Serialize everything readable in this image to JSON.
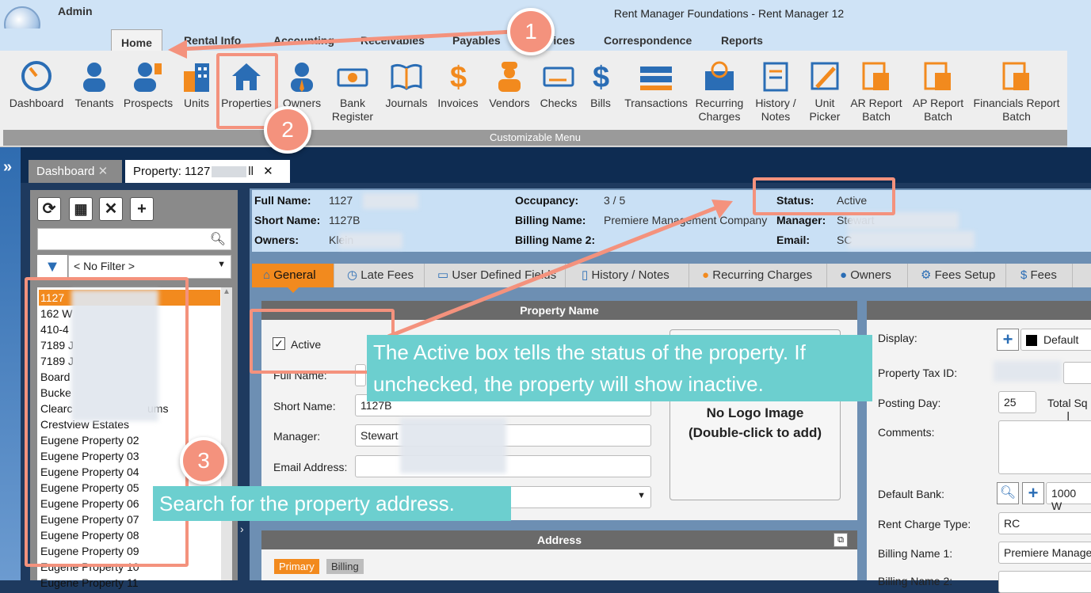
{
  "app": {
    "title": "Rent Manager Foundations - Rent Manager 12"
  },
  "menu_tabs": [
    "Admin",
    "Home",
    "Rental Info",
    "Accounting",
    "Receivables",
    "Payables",
    "Services",
    "Correspondence",
    "Reports"
  ],
  "ribbon": {
    "buttons": [
      "Dashboard",
      "Tenants",
      "Prospects",
      "Units",
      "Properties",
      "Owners",
      "Bank Register",
      "Journals",
      "Invoices",
      "Vendors",
      "Checks",
      "Bills",
      "Transactions",
      "Recurring Charges",
      "History / Notes",
      "Unit Picker",
      "AR Report Batch",
      "AP Report Batch",
      "Financials Report Batch"
    ],
    "footer": "Customizable Menu"
  },
  "doc_tabs": {
    "dashboard": "Dashboard",
    "property": "Property: 1127",
    "property_tail": "ll"
  },
  "sidebar": {
    "filter": "< No Filter >",
    "items": [
      "1127",
      "162 W",
      "410-4",
      "7189 J",
      "7189 J",
      "Board",
      "Bucke",
      "Clearc",
      "Crestview Estates",
      "Eugene Property 02",
      "Eugene Property 03",
      "Eugene Property 04",
      "Eugene Property 05",
      "Eugene Property 06",
      "Eugene Property 07",
      "Eugene Property 08",
      "Eugene Property 09",
      "Eugene Property 10",
      "Eugene Property 11"
    ],
    "clearc_tail": "ums"
  },
  "info": {
    "full_name_label": "Full Name:",
    "full_name": "1127",
    "short_name_label": "Short Name:",
    "short_name": "1127B",
    "owners_label": "Owners:",
    "owners": "Klein",
    "occupancy_label": "Occupancy:",
    "occupancy": "3 / 5",
    "billing_name_label": "Billing Name:",
    "billing_name": "Premiere Management Company",
    "billing_name2_label": "Billing Name 2:",
    "status_label": "Status:",
    "status": "Active",
    "manager_label": "Manager:",
    "manager": "Stewart",
    "email_label": "Email:",
    "email": "SC"
  },
  "prop_tabs": [
    "General",
    "Late Fees",
    "User Defined Fields",
    "History / Notes",
    "Recurring Charges",
    "Owners",
    "Fees Setup",
    "Fees"
  ],
  "property_name_panel": {
    "title": "Property Name",
    "active_label": "Active",
    "full_name_label": "Full Name:",
    "short_name_label": "Short Name:",
    "short_name": "1127B",
    "manager_label": "Manager:",
    "manager": "Stewart",
    "email_label": "Email Address:",
    "logo_text_1": "No Logo Image",
    "logo_text_2": "(Double-click to add)"
  },
  "address_panel": {
    "title": "Address",
    "tab_primary": "Primary",
    "tab_billing": "Billing"
  },
  "right_panel": {
    "display_label": "Display:",
    "display_value": "Default",
    "tax_label": "Property Tax ID:",
    "posting_label": "Posting Day:",
    "posting_value": "25",
    "total_sq": "Total Sq",
    "comments_label": "Comments:",
    "bank_label": "Default Bank:",
    "bank_value": "1000 W",
    "rent_label": "Rent Charge Type:",
    "rent_value": "RC",
    "billing1_label": "Billing Name 1:",
    "billing1_value": "Premiere Manage",
    "billing2_label": "Billing Name 2:"
  },
  "callouts": {
    "one": "1",
    "two": "2",
    "three": "3",
    "note_active": "The Active box tells the status of the property. If unchecked, the property will show inactive.",
    "note_search": "Search for the property address."
  },
  "colors": {
    "accent_orange": "#f28a1e",
    "callout": "#f4927d",
    "note": "#6ccfcf"
  }
}
